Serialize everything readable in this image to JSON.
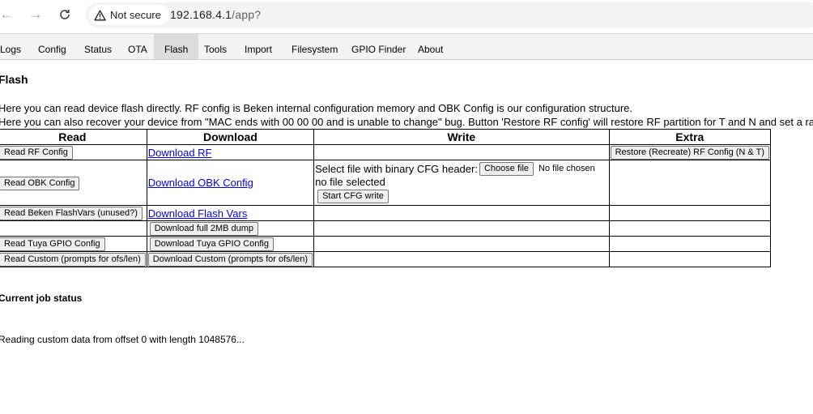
{
  "browser": {
    "security_label": "Not secure",
    "url_host": "192.168.4.1",
    "url_path": "/app?",
    "icons": [
      "back-arrow-icon",
      "forward-arrow-icon",
      "reload-icon",
      "warning-triangle-icon"
    ]
  },
  "tabs": [
    {
      "label": "Logs",
      "active": false
    },
    {
      "label": "Config",
      "active": false
    },
    {
      "label": "Status",
      "active": false
    },
    {
      "label": "OTA",
      "active": false
    },
    {
      "label": "Flash",
      "active": true
    },
    {
      "label": "Tools",
      "active": false
    },
    {
      "label": "Import",
      "active": false
    },
    {
      "label": "Filesystem",
      "active": false
    },
    {
      "label": "GPIO Finder",
      "active": false
    },
    {
      "label": "About",
      "active": false
    }
  ],
  "page": {
    "title": "Flash",
    "desc1": "Here you can read device flash directly. RF config is Beken internal configuration memory and OBK Config is our configuration structure.",
    "desc2": "Here you can also recover your device from \"MAC ends with 00 00 00 and is unable to change\" bug. Button 'Restore RF config' will restore RF partition for T and N and set a random"
  },
  "table": {
    "headers": {
      "read": "Read",
      "download": "Download",
      "write": "Write",
      "extra": "Extra"
    },
    "rows": {
      "rf": {
        "read": "Read RF Config",
        "download": "Download RF",
        "extra": "Restore (Recreate) RF Config (N & T)"
      },
      "obk": {
        "read": "Read OBK Config",
        "download": "Download OBK Config",
        "write_label": "Select file with binary CFG header:",
        "choose_file": "Choose file",
        "no_file_chosen": "No file chosen",
        "no_file_selected": "no file selected",
        "start_write": "Start CFG write"
      },
      "flashvars": {
        "read": "Read Beken FlashVars (unused?)",
        "download": "Download Flash Vars"
      },
      "full": {
        "download": "Download full 2MB dump"
      },
      "tuya": {
        "read": "Read Tuya GPIO Config",
        "download": "Download Tuya GPIO Config"
      },
      "custom": {
        "read": "Read Custom (prompts for ofs/len)",
        "download": "Download Custom (prompts for ofs/len)"
      }
    }
  },
  "job": {
    "title": "Current job status",
    "status": "Reading custom data from offset 0 with length 1048576..."
  }
}
